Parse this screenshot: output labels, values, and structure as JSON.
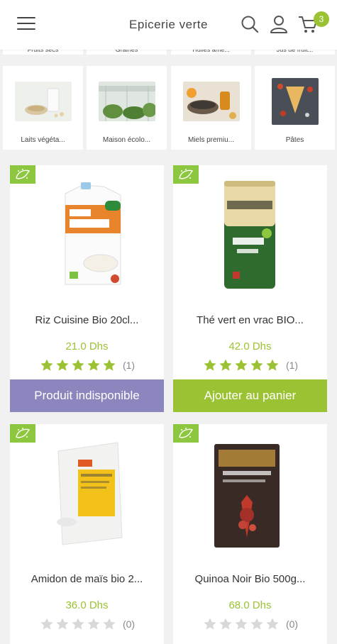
{
  "header": {
    "title": "Epicerie verte",
    "cart_count": "3"
  },
  "categories_partial": [
    "Fruits secs",
    "Graines",
    "Huiles ame...",
    "Jus de fruit..."
  ],
  "categories": [
    {
      "label": "Laits végéta...",
      "icon": "plant-milk-thumbnail"
    },
    {
      "label": "Maison écolo...",
      "icon": "greenhouse-thumbnail"
    },
    {
      "label": "Miels premiu...",
      "icon": "honey-thumbnail"
    },
    {
      "label": "Pâtes",
      "icon": "pasta-thumbnail"
    }
  ],
  "products": [
    {
      "name": "Riz Cuisine Bio 20cl...",
      "price": "21.0 Dhs",
      "rating": 5,
      "rating_count": "(1)",
      "action": "Produit indisponible",
      "action_color": "#8b86bd"
    },
    {
      "name": "Thé vert en vrac BIO...",
      "price": "42.0 Dhs",
      "rating": 5,
      "rating_count": "(1)",
      "action": "Ajouter au panier",
      "action_color": "#9bc232"
    },
    {
      "name": "Amidon de maïs bio 2...",
      "price": "36.0 Dhs",
      "rating": 0,
      "rating_count": "(0)"
    },
    {
      "name": "Quinoa Noir Bio 500g...",
      "price": "68.0 Dhs",
      "rating": 0,
      "rating_count": "(0)"
    }
  ],
  "colors": {
    "accent": "#9bc232",
    "unavailable": "#8b86bd",
    "bio_badge": "#8dc63f",
    "star_filled": "#9bc232",
    "star_empty": "#d8d8d8"
  }
}
